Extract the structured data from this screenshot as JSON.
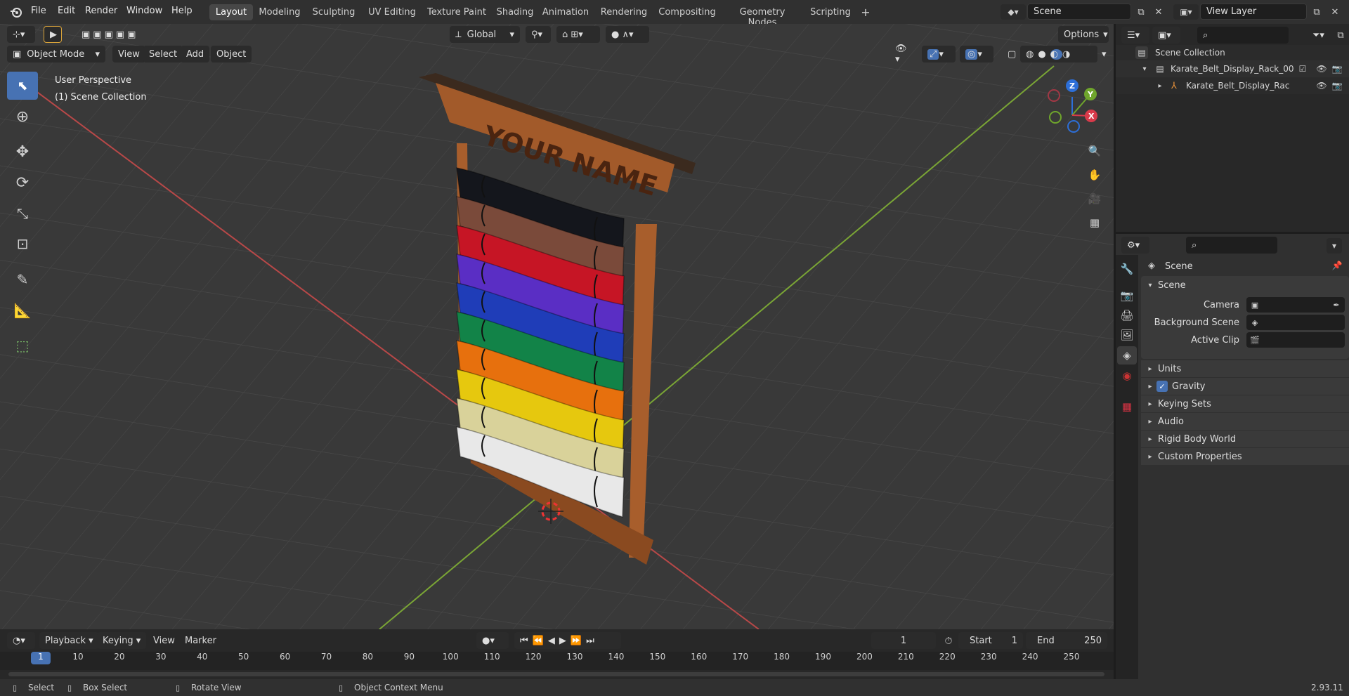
{
  "topbar": {
    "menus": [
      "File",
      "Edit",
      "Render",
      "Window",
      "Help"
    ],
    "workspaces": [
      "Layout",
      "Modeling",
      "Sculpting",
      "UV Editing",
      "Texture Paint",
      "Shading",
      "Animation",
      "Rendering",
      "Compositing",
      "Geometry Nodes",
      "Scripting"
    ],
    "active_workspace": "Layout",
    "scene_name": "Scene",
    "view_layer": "View Layer"
  },
  "viewport": {
    "mode": "Object Mode",
    "menus": [
      "View",
      "Select",
      "Add",
      "Object"
    ],
    "orientation": "Global",
    "options_label": "Options",
    "perspective_label": "User Perspective",
    "collection_label": "(1) Scene Collection",
    "rack_text": "YOUR NAME",
    "belt_colors": [
      "#14161c",
      "#7a4a3a",
      "#c61525",
      "#5a2ec4",
      "#1f3db8",
      "#128348",
      "#e7700d",
      "#e6c80e",
      "#d9d29a",
      "#e8e8e8"
    ],
    "gizmo": {
      "z": "Z",
      "y": "Y",
      "x": "X"
    }
  },
  "timeline": {
    "menus": [
      "Playback",
      "Keying",
      "View",
      "Marker"
    ],
    "current_frame": "1",
    "start_label": "Start",
    "start_value": "1",
    "end_label": "End",
    "end_value": "250",
    "frames": [
      "1",
      "10",
      "20",
      "30",
      "40",
      "50",
      "60",
      "70",
      "80",
      "90",
      "100",
      "110",
      "120",
      "130",
      "140",
      "150",
      "160",
      "170",
      "180",
      "190",
      "200",
      "210",
      "220",
      "230",
      "240",
      "250"
    ]
  },
  "statusbar": {
    "select": "Select",
    "box_select": "Box Select",
    "rotate_view": "Rotate View",
    "context_menu": "Object Context Menu",
    "version": "2.93.11"
  },
  "outliner": {
    "root": "Scene Collection",
    "collection": "Karate_Belt_Display_Rack_00",
    "object": "Karate_Belt_Display_Rac"
  },
  "properties": {
    "context": "Scene",
    "panel": "Scene",
    "camera_label": "Camera",
    "background_label": "Background Scene",
    "clip_label": "Active Clip",
    "sections": [
      "Units",
      "Gravity",
      "Keying Sets",
      "Audio",
      "Rigid Body World",
      "Custom Properties"
    ],
    "gravity_checked": true
  }
}
